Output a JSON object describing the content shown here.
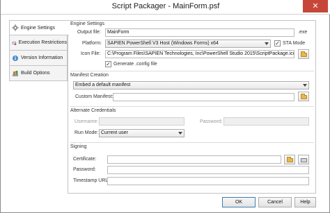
{
  "window": {
    "title": "Script Packager - MainForm.psf",
    "close_glyph": "✕"
  },
  "tabs": [
    {
      "label": "Engine Settings",
      "icon": "gear-icon",
      "active": true
    },
    {
      "label": "Execution Restrictions",
      "icon": "restriction-icon",
      "active": false
    },
    {
      "label": "Version Information",
      "icon": "version-info-icon",
      "active": false
    },
    {
      "label": "Build Options",
      "icon": "build-options-icon",
      "active": false
    }
  ],
  "engine_settings": {
    "group_title": "Engine Settings",
    "output_file_label": "Output file:",
    "output_file_value": "MainForm",
    "output_ext": ".exe",
    "platform_label": "Platform:",
    "platform_value": "SAPIEN PowerShell V3 Host (Windows Forms) x64",
    "sta_mode_label": "STA Mode",
    "sta_mode_checked": "✓",
    "icon_file_label": "Icon File:",
    "icon_file_value": "C:\\Program Files\\SAPIEN Technologies, Inc\\PowerShell Studio 2015\\ScriptPackage.ico",
    "generate_config_label": "Generate .config file",
    "generate_config_checked": "✓"
  },
  "manifest": {
    "group_title": "Manifest Creation",
    "selected": "Embed a default manifest",
    "custom_manifest_label": "Custom Manifest:",
    "custom_manifest_value": ""
  },
  "credentials": {
    "group_title": "Alternate Credentials",
    "username_label": "Username:",
    "username_value": "",
    "password_label": "Password:",
    "password_value": "",
    "run_mode_label": "Run Mode:",
    "run_mode_value": "Current user"
  },
  "signing": {
    "group_title": "Signing",
    "certificate_label": "Certificate:",
    "certificate_value": "",
    "password_label": "Password:",
    "password_value": "",
    "timestamp_label": "Timestamp URL:",
    "timestamp_value": ""
  },
  "buttons": {
    "ok": "OK",
    "cancel": "Cancel",
    "help": "Help"
  },
  "colors": {
    "close_button": "#c7463a",
    "default_button_border": "#3c7fb1"
  }
}
